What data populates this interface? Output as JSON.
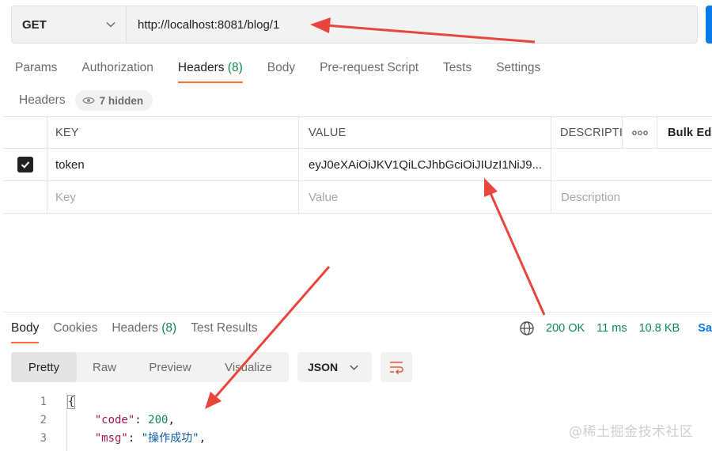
{
  "request": {
    "method": "GET",
    "url": "http://localhost:8081/blog/1",
    "tabs": [
      {
        "label": "Params",
        "count": ""
      },
      {
        "label": "Authorization",
        "count": ""
      },
      {
        "label": "Headers",
        "count": "(8)"
      },
      {
        "label": "Body",
        "count": ""
      },
      {
        "label": "Pre-request Script",
        "count": ""
      },
      {
        "label": "Tests",
        "count": ""
      },
      {
        "label": "Settings",
        "count": ""
      }
    ],
    "active_tab": "Headers"
  },
  "headers_panel": {
    "title": "Headers",
    "hidden_label": "7 hidden",
    "columns": {
      "key": "KEY",
      "value": "VALUE",
      "description": "DESCRIPTION",
      "bulk_edit": "Bulk Edit"
    },
    "rows": [
      {
        "checked": true,
        "key": "token",
        "value": "eyJ0eXAiOiJKV1QiLCJhbGciOiJIUzI1NiJ9..."
      }
    ],
    "placeholders": {
      "key": "Key",
      "value": "Value",
      "description": "Description"
    }
  },
  "response": {
    "tabs": [
      {
        "label": "Body",
        "count": ""
      },
      {
        "label": "Cookies",
        "count": ""
      },
      {
        "label": "Headers",
        "count": "(8)"
      },
      {
        "label": "Test Results",
        "count": ""
      }
    ],
    "active_tab": "Body",
    "status": "200 OK",
    "time": "11 ms",
    "size": "10.8 KB",
    "save_label": "Save",
    "views": [
      "Pretty",
      "Raw",
      "Preview",
      "Visualize"
    ],
    "active_view": "Pretty",
    "format": "JSON",
    "lines": [
      {
        "n": "1",
        "text": "{"
      },
      {
        "n": "2",
        "key": "\"code\"",
        "value": "200",
        "type": "number"
      },
      {
        "n": "3",
        "key": "\"msg\"",
        "value": "\"操作成功\"",
        "type": "string"
      }
    ]
  },
  "watermark": "@稀土掘金技术社区",
  "colors": {
    "accent": "#ff6c37",
    "primary": "#097bed",
    "success": "#0d8a4f",
    "annotation": "#e8463c"
  }
}
